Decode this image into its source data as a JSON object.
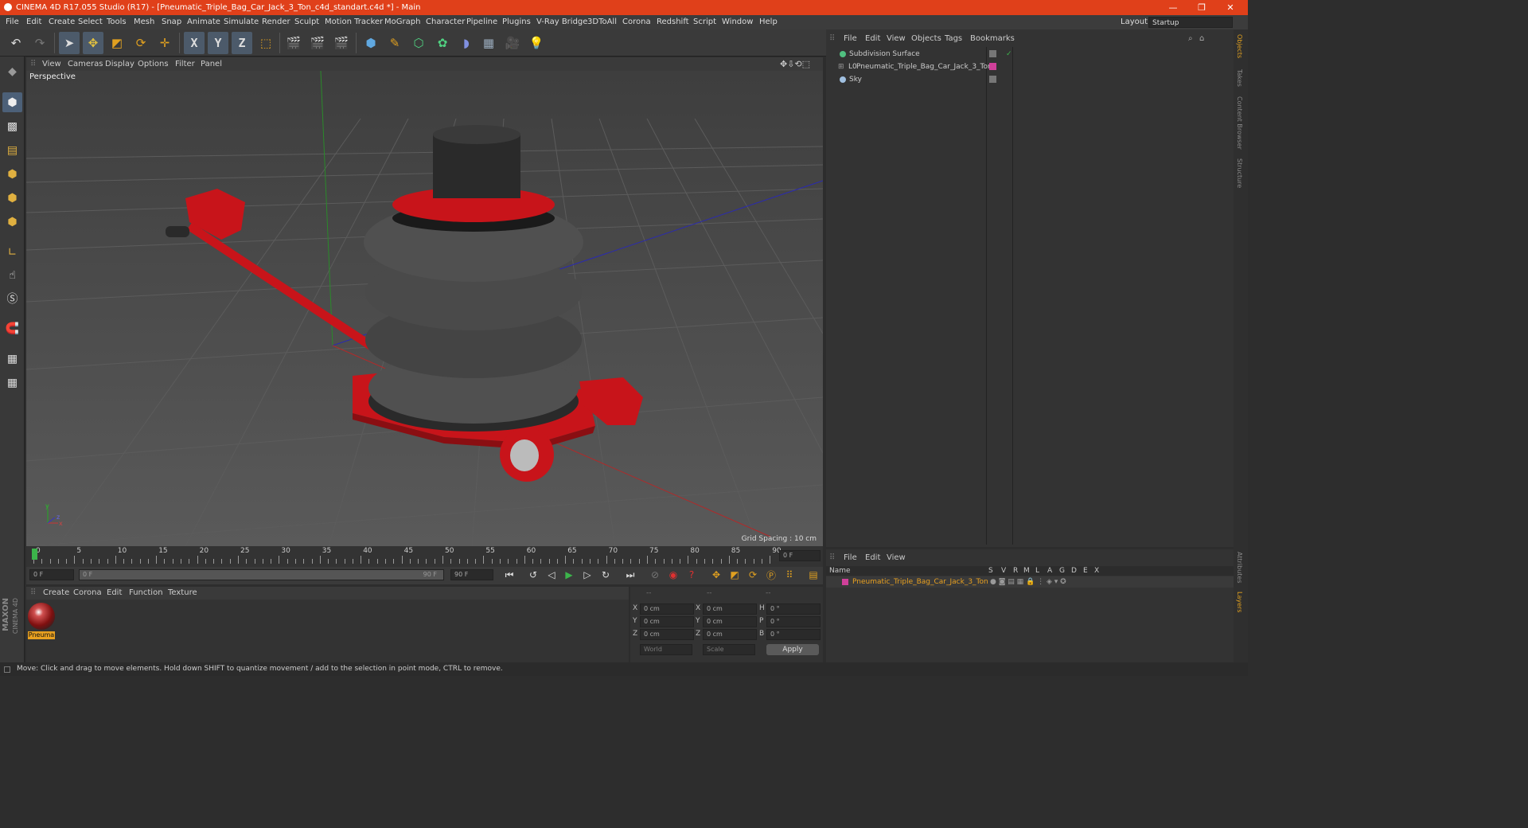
{
  "titlebar": {
    "title": "CINEMA 4D R17.055 Studio (R17) - [Pneumatic_Triple_Bag_Car_Jack_3_Ton_c4d_standart.c4d *] - Main",
    "minimize": "—",
    "restore": "❐",
    "close": "✕"
  },
  "menu": [
    "File",
    "Edit",
    "Create",
    "Select",
    "Tools",
    "Mesh",
    "Snap",
    "Animate",
    "Simulate",
    "Render",
    "Sculpt",
    "Motion Tracker",
    "MoGraph",
    "Character",
    "Pipeline",
    "Plugins",
    "V-Ray Bridge",
    "3DToAll",
    "Corona",
    "Redshift",
    "Script",
    "Window",
    "Help"
  ],
  "layout": {
    "label": "Layout:",
    "value": "Startup"
  },
  "toolbar_axes": [
    "X",
    "Y",
    "Z"
  ],
  "viewport": {
    "menu": [
      "View",
      "Cameras",
      "Display",
      "Options",
      "Filter",
      "Panel"
    ],
    "label": "Perspective",
    "grid_spacing": "Grid Spacing : 10 cm",
    "axis_labels": {
      "y": "y",
      "x": "x",
      "z": "z"
    }
  },
  "timeline": {
    "ticks": [
      "0",
      "5",
      "10",
      "15",
      "20",
      "25",
      "30",
      "35",
      "40",
      "45",
      "50",
      "55",
      "60",
      "65",
      "70",
      "75",
      "80",
      "85",
      "90"
    ],
    "current_frame": "0 F",
    "start": "0 F",
    "range_start": "0 F",
    "range_end": "90 F",
    "end": "90 F"
  },
  "material_menu": [
    "Create",
    "Corona",
    "Edit",
    "Function",
    "Texture"
  ],
  "material": {
    "name": "Pneuma"
  },
  "coords": {
    "headers": [
      "--",
      "--",
      "--"
    ],
    "rows": [
      {
        "a": "X",
        "av": "0 cm",
        "b": "X",
        "bv": "0 cm",
        "c": "H",
        "cv": "0 °"
      },
      {
        "a": "Y",
        "av": "0 cm",
        "b": "Y",
        "bv": "0 cm",
        "c": "P",
        "cv": "0 °"
      },
      {
        "a": "Z",
        "av": "0 cm",
        "b": "Z",
        "bv": "0 cm",
        "c": "B",
        "cv": "0 °"
      }
    ],
    "world": "World",
    "scale": "Scale",
    "apply": "Apply"
  },
  "objects_menu": [
    "File",
    "Edit",
    "View",
    "Objects",
    "Tags",
    "Bookmarks"
  ],
  "objects": [
    {
      "name": "Subdivision Surface",
      "icon": "subdivision-icon"
    },
    {
      "name": "Pneumatic_Triple_Bag_Car_Jack_3_Ton",
      "icon": "null-object-icon"
    },
    {
      "name": "Sky",
      "icon": "sky-icon"
    }
  ],
  "layers_menu": [
    "File",
    "Edit",
    "View"
  ],
  "layers_header": {
    "name": "Name",
    "cols": [
      "S",
      "V",
      "R",
      "M",
      "L",
      "A",
      "G",
      "D",
      "E",
      "X"
    ]
  },
  "layers": [
    {
      "name": "Pneumatic_Triple_Bag_Car_Jack_3_Ton"
    }
  ],
  "right_tabs": [
    "Objects",
    "Takes",
    "Content Browser",
    "Structure"
  ],
  "right_tabs_bottom": [
    "Attributes",
    "Layers"
  ],
  "brand": {
    "maxon": "MAXON",
    "product": "CINEMA 4D"
  },
  "status": "Move: Click and drag to move elements. Hold down SHIFT to quantize movement / add to the selection in point mode, CTRL to remove.",
  "colors": {
    "accent": "#e0401a",
    "jack_red": "#c8141a",
    "layer_orange": "#e8a020",
    "layer_pink": "#d0409a"
  }
}
